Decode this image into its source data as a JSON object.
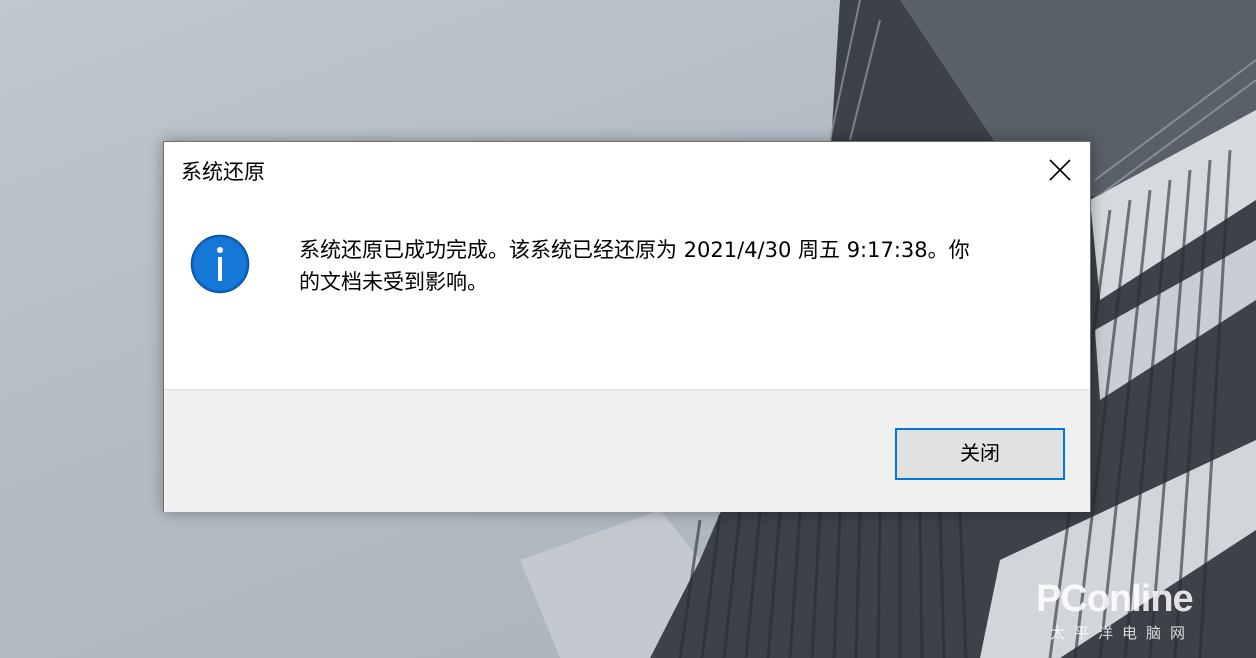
{
  "dialog": {
    "title": "系统还原",
    "message_line1": "系统还原已成功完成。该系统已经还原为 2021/4/30 周五 9:17:38。你",
    "message_line2": "的文档未受到影响。",
    "close_button_label": "关闭",
    "icon": "info-icon",
    "accent_color": "#0078d7"
  },
  "watermark": {
    "logo": "PConline",
    "subtitle": "太平洋电脑网"
  }
}
